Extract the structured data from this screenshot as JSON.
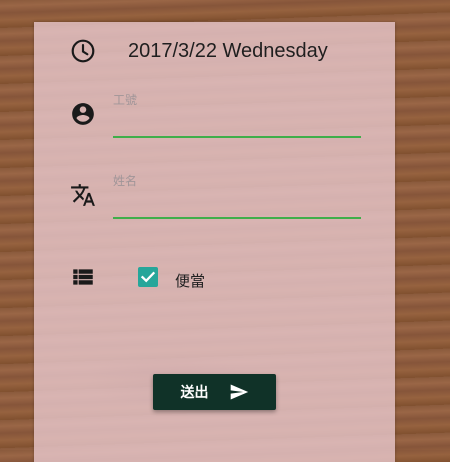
{
  "header": {
    "date": "2017/3/22 Wednesday",
    "icon": "clock-icon"
  },
  "form": {
    "employee_id": {
      "label": "工號",
      "value": "",
      "icon": "account-circle-icon"
    },
    "name": {
      "label": "姓名",
      "value": "",
      "icon": "translate-icon"
    },
    "lunchbox": {
      "label": "便當",
      "checked": true,
      "icon": "list-icon"
    },
    "submit_label": "送出"
  },
  "colors": {
    "panel": "#e8c8cd",
    "underline": "#3fae4a",
    "checkbox": "#26a69a",
    "button": "#103228"
  }
}
